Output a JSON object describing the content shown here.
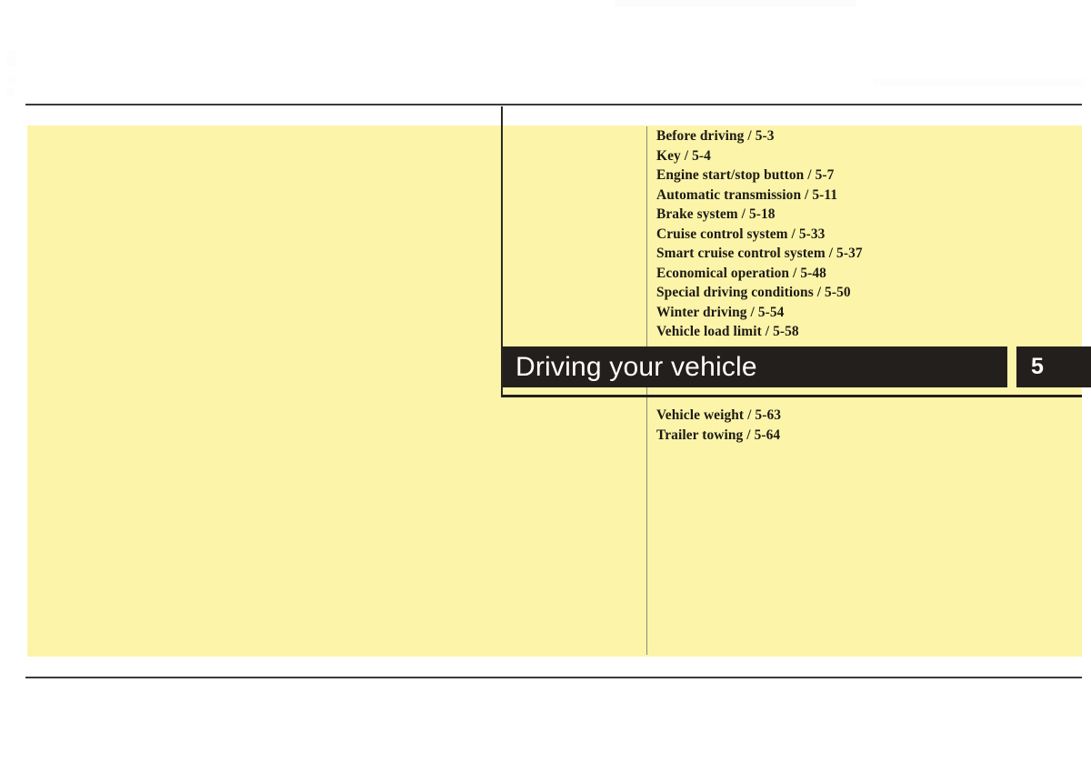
{
  "page": {
    "background_color": "#ffffff",
    "panel_color": "#fcf4a9",
    "rule_color": "#3c3a38",
    "bar_color": "#231f1d",
    "bar_text_color": "#ffffff",
    "toc_text_color": "#1d1a14"
  },
  "chapter": {
    "title": "Driving your vehicle",
    "number": "5"
  },
  "toc": {
    "upper_items": [
      "Before driving / 5-3",
      "Key / 5-4",
      "Engine start/stop button / 5-7",
      "Automatic transmission / 5-11",
      "Brake system / 5-18",
      "Cruise control system / 5-33",
      "Smart cruise control system / 5-37",
      "Economical operation / 5-48",
      "Special driving conditions / 5-50",
      "Winter driving / 5-54",
      "Vehicle load limit / 5-58"
    ],
    "lower_items": [
      "Vehicle weight / 5-63",
      "Trailer towing / 5-64"
    ]
  }
}
